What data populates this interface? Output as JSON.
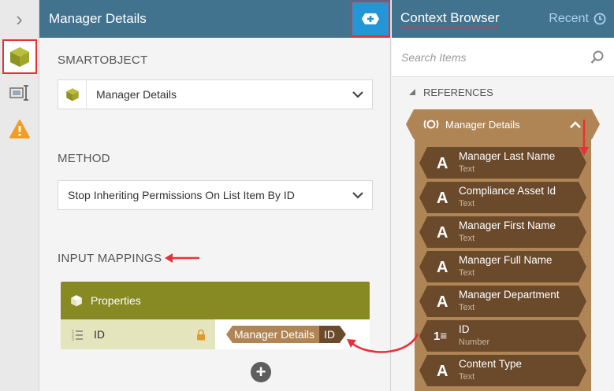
{
  "rail": {
    "expand_icon": "chevron-right-icon"
  },
  "middle": {
    "title": "Manager Details",
    "smartobject_label": "SMARTOBJECT",
    "smartobject_value": "Manager Details",
    "method_label": "METHOD",
    "method_value": "Stop Inheriting Permissions On List Item By ID",
    "input_mappings_label": "INPUT MAPPINGS",
    "properties": {
      "header": "Properties",
      "rows": [
        {
          "name": "ID",
          "mapped_source": "Manager Details",
          "mapped_field": "ID"
        }
      ]
    }
  },
  "context": {
    "title": "Context Browser",
    "recent_label": "Recent",
    "search_placeholder": "Search Items",
    "references_label": "REFERENCES",
    "group_title": "Manager Details",
    "items": [
      {
        "name": "Manager Last Name",
        "type": "Text",
        "glyph": "A"
      },
      {
        "name": "Compliance Asset Id",
        "type": "Text",
        "glyph": "A"
      },
      {
        "name": "Manager First Name",
        "type": "Text",
        "glyph": "A"
      },
      {
        "name": "Manager Full Name",
        "type": "Text",
        "glyph": "A"
      },
      {
        "name": "Manager Department",
        "type": "Text",
        "glyph": "A"
      },
      {
        "name": "ID",
        "type": "Number",
        "glyph": "1≡"
      },
      {
        "name": "Content Type",
        "type": "Text",
        "glyph": "A"
      }
    ]
  },
  "colors": {
    "header_blue": "#41728e",
    "highlight_red": "#e53238",
    "smartobject_olive": "#878a22",
    "context_tan": "#b08555",
    "context_brown": "#6b4a2c",
    "warning_orange": "#f39c23"
  }
}
